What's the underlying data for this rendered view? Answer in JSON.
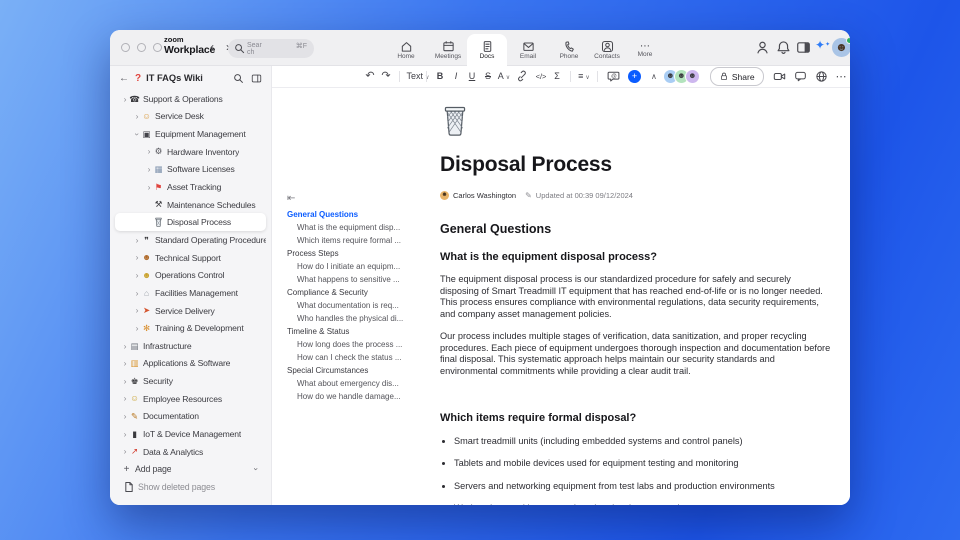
{
  "titlebar": {
    "brand_top": "zoom",
    "brand_bottom": "Workplace",
    "search": {
      "placeholder": "Search",
      "shortcut": "⌘F"
    }
  },
  "nav": {
    "tabs": [
      {
        "label": "Home",
        "icon": "home-icon",
        "active": false
      },
      {
        "label": "Meetings",
        "icon": "calendar-icon",
        "active": false
      },
      {
        "label": "Docs",
        "icon": "document-icon",
        "active": true
      },
      {
        "label": "Email",
        "icon": "envelope-icon",
        "active": false
      },
      {
        "label": "Phone",
        "icon": "phone-icon",
        "active": false
      },
      {
        "label": "Contacts",
        "icon": "contacts-icon",
        "active": false
      },
      {
        "label": "More",
        "icon": "ellipsis-icon",
        "active": false
      }
    ]
  },
  "sidebar": {
    "title": "IT FAQs Wiki",
    "items": [
      {
        "label": "Support & Operations",
        "level": 0,
        "chevron": "right",
        "icon": "phone-receiver-icon",
        "glyph": "☎",
        "color": "#3a3a3e",
        "selected": false
      },
      {
        "label": "Service Desk",
        "level": 1,
        "chevron": "right",
        "icon": "service-desk-person-icon",
        "glyph": "☺",
        "color": "#d9983a",
        "selected": false
      },
      {
        "label": "Equipment Management",
        "level": 1,
        "chevron": "down",
        "icon": "computer-monitor-icon",
        "glyph": "▣",
        "color": "#43434a",
        "selected": false
      },
      {
        "label": "Hardware Inventory",
        "level": 2,
        "chevron": "right",
        "icon": "mechanical-arm-icon",
        "glyph": "⚙",
        "color": "#4f4f56",
        "selected": false
      },
      {
        "label": "Software Licenses",
        "level": 2,
        "chevron": "right",
        "icon": "software-window-icon",
        "glyph": "▦",
        "color": "#7f93ad",
        "selected": false
      },
      {
        "label": "Asset Tracking",
        "level": 2,
        "chevron": "right",
        "icon": "round-pushpin-icon",
        "glyph": "⚑",
        "color": "#e0443e",
        "selected": false
      },
      {
        "label": "Maintenance Schedules",
        "level": 2,
        "chevron": "none",
        "icon": "hammer-and-wrench-icon",
        "glyph": "⚒",
        "color": "#3a3a3e",
        "selected": false
      },
      {
        "label": "Disposal Process",
        "level": 2,
        "chevron": "none",
        "icon": "wastebasket-icon",
        "glyph": "",
        "color": "#6a7078",
        "selected": true
      },
      {
        "label": "Standard Operating Procedures",
        "level": 1,
        "chevron": "right",
        "icon": "procedures-icon",
        "glyph": "❞",
        "color": "#3a3a3e",
        "selected": false
      },
      {
        "label": "Technical Support",
        "level": 1,
        "chevron": "right",
        "icon": "technician-person-icon",
        "glyph": "☻",
        "color": "#b06a2a",
        "selected": false
      },
      {
        "label": "Operations Control",
        "level": 1,
        "chevron": "right",
        "icon": "operator-person-icon",
        "glyph": "☻",
        "color": "#c9a22e",
        "selected": false
      },
      {
        "label": "Facilities Management",
        "level": 1,
        "chevron": "right",
        "icon": "building-icon",
        "glyph": "⌂",
        "color": "#9aa0a8",
        "selected": false
      },
      {
        "label": "Service Delivery",
        "level": 1,
        "chevron": "right",
        "icon": "delivery-truck-icon",
        "glyph": "➤",
        "color": "#d4542e",
        "selected": false
      },
      {
        "label": "Training & Development",
        "level": 1,
        "chevron": "right",
        "icon": "training-icon",
        "glyph": "✻",
        "color": "#d98f2f",
        "selected": false
      },
      {
        "label": "Infrastructure",
        "level": 0,
        "chevron": "right",
        "icon": "infrastructure-icon",
        "glyph": "▤",
        "color": "#6f747c",
        "selected": false
      },
      {
        "label": "Applications & Software",
        "level": 0,
        "chevron": "right",
        "icon": "applications-icon",
        "glyph": "▥",
        "color": "#d9952f",
        "selected": false
      },
      {
        "label": "Security",
        "level": 0,
        "chevron": "right",
        "icon": "guard-icon",
        "glyph": "♚",
        "color": "#3a3a3e",
        "selected": false
      },
      {
        "label": "Employee Resources",
        "level": 0,
        "chevron": "right",
        "icon": "employee-person-icon",
        "glyph": "☺",
        "color": "#c9a22e",
        "selected": false
      },
      {
        "label": "Documentation",
        "level": 0,
        "chevron": "right",
        "icon": "memo-pencil-icon",
        "glyph": "✎",
        "color": "#b8761e",
        "selected": false
      },
      {
        "label": "IoT & Device Management",
        "level": 0,
        "chevron": "right",
        "icon": "mobile-device-icon",
        "glyph": "▮",
        "color": "#3a3a3e",
        "selected": false
      },
      {
        "label": "Data & Analytics",
        "level": 0,
        "chevron": "right",
        "icon": "chart-increasing-icon",
        "glyph": "↗",
        "color": "#d33a2c",
        "selected": false
      }
    ],
    "add_page_label": "Add page",
    "show_deleted_label": "Show deleted pages"
  },
  "doc_toolbar": {
    "text_style_label": "Text",
    "bold_label": "B",
    "italic_label": "I",
    "underline_label": "U",
    "strikethrough_label": "S",
    "color_label": "A",
    "code_label": "</>",
    "equation_label": "Σ",
    "align_label": "≡",
    "share_label": "Share"
  },
  "toc": {
    "sections": [
      {
        "title": "General Questions",
        "active": true,
        "items": [
          "What is the equipment disp...",
          "Which items require formal ..."
        ]
      },
      {
        "title": "Process Steps",
        "active": false,
        "items": [
          "How do I initiate an equipm...",
          "What happens to sensitive ..."
        ]
      },
      {
        "title": "Compliance & Security",
        "active": false,
        "items": [
          "What documentation is req...",
          "Who handles the physical di..."
        ]
      },
      {
        "title": "Timeline & Status",
        "active": false,
        "items": [
          "How long does the process ...",
          "How can I check the status ..."
        ]
      },
      {
        "title": "Special Circumstances",
        "active": false,
        "items": [
          "What about emergency dis...",
          "How do we handle damage..."
        ]
      }
    ]
  },
  "document": {
    "icon": "wastebasket-icon",
    "title": "Disposal Process",
    "author": "Carlos Washington",
    "updated": "Updated at 00:39 09/12/2024",
    "section_heading": "General Questions",
    "q1_heading": "What is the equipment disposal process?",
    "q1_p1": "The equipment disposal process is our standardized procedure for safely and securely disposing of Smart Treadmill IT equipment that has reached end-of-life or is no longer needed. This process ensures compliance with environmental regulations, data security requirements, and company asset management policies.",
    "q1_p2": "Our process includes multiple stages of verification, data sanitization, and proper recycling procedures. Each piece of equipment undergoes thorough inspection and documentation before final disposal. This systematic approach helps maintain our security standards and environmental commitments while providing a clear audit trail.",
    "q2_heading": "Which items require formal disposal?",
    "q2_bullets": [
      "Smart treadmill units (including embedded systems and control panels)",
      "Tablets and mobile devices used for equipment testing and monitoring",
      "Servers and networking equipment from test labs and production environments",
      "Workstations and laptops assigned to development and support teams"
    ]
  }
}
